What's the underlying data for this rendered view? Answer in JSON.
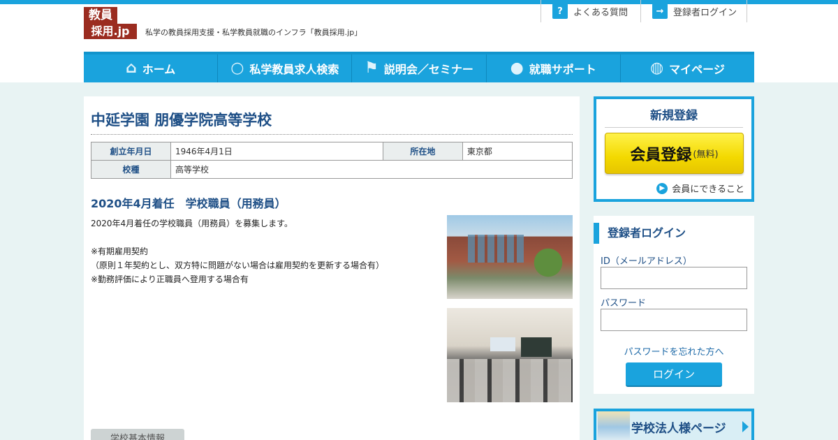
{
  "header": {
    "logo_line1": "教員",
    "logo_line2": "採用.jp",
    "tagline": "私学の教員採用支援・私学教員就職のインフラ「教員採用.jp」",
    "faq": "よくある質問",
    "login": "登録者ログイン",
    "faq_icon": "?",
    "login_icon": "→"
  },
  "nav": [
    {
      "label": "ホーム",
      "icon": "home-icon",
      "glyph": "⌂"
    },
    {
      "label": "私学教員求人検索",
      "icon": "magnifier-icon",
      "glyph": "○"
    },
    {
      "label": "説明会／セミナー",
      "icon": "flag-icon",
      "glyph": "⚑"
    },
    {
      "label": "就職サポート",
      "icon": "speech-bubbles-icon",
      "glyph": "●"
    },
    {
      "label": "マイページ",
      "icon": "person-icon",
      "glyph": "◍"
    }
  ],
  "school": {
    "name": "中延学園 朋優学院高等学校",
    "founded_label": "創立年月日",
    "founded": "1946年4月1日",
    "location_label": "所在地",
    "location": "東京都",
    "type_label": "校種",
    "type": "高等学校"
  },
  "job": {
    "title": "2020年4月着任　学校職員（用務員）",
    "para1": "2020年4月着任の学校職員（用務員）を募集します。",
    "line1": "※有期雇用契約",
    "line2": "（原則１年契約とし、双方特に問題がない場合は雇用契約を更新する場合有）",
    "line3": "※勤務評価により正職員へ登用する場合有",
    "tab": "学校基本情報"
  },
  "sidebar": {
    "register_heading": "新規登録",
    "register_button": "会員登録",
    "register_free": "(無料)",
    "member_benefits": "会員にできること",
    "login_heading": "登録者ログイン",
    "id_label": "ID（メールアドレス）",
    "password_label": "パスワード",
    "forgot": "パスワードを忘れた方へ",
    "login_button": "ログイン",
    "corp_page": "学校法人様ページ"
  },
  "colors": {
    "accent": "#1aa3dd",
    "heading": "#1e4f86",
    "logo": "#9b2c20",
    "cta": "#f3d900"
  }
}
